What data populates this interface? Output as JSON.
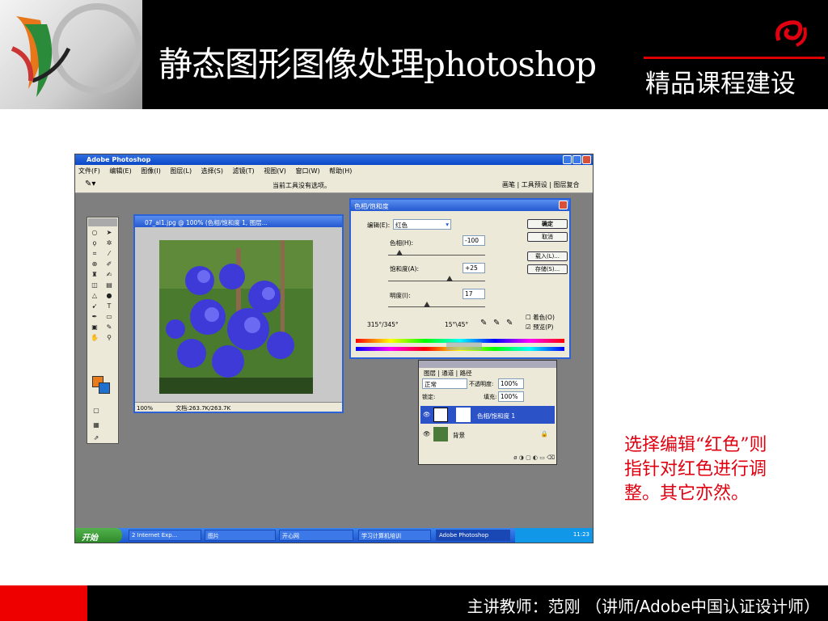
{
  "header": {
    "title": "静态图形图像处理photoshop",
    "subtitle": "精品课程建设"
  },
  "caption": "选择编辑“红色”则指针对红色进行调整。其它亦然。",
  "footer": {
    "teacher": "主讲教师：范刚 （讲师/Adobe中国认证设计师）"
  },
  "screenshot": {
    "app_title": "Adobe Photoshop",
    "menu": [
      "文件(F)",
      "编辑(E)",
      "图像(I)",
      "图层(L)",
      "选择(S)",
      "滤镜(T)",
      "视图(V)",
      "窗口(W)",
      "帮助(H)"
    ],
    "options_hint": "当前工具没有选项。",
    "options_tabs": "画笔 | 工具预设 | 图层复合",
    "document": {
      "title": "07_al1.jpg @ 100% (色相/饱和度 1, 图层...",
      "zoom": "100%",
      "doc_size": "文档:263.7K/263.7K"
    },
    "hue_dialog": {
      "title": "色相/饱和度",
      "edit_label": "编辑(E):",
      "edit_value": "红色",
      "hue_label": "色相(H):",
      "hue_value": "-100",
      "saturation_label": "饱和度(A):",
      "saturation_value": "+25",
      "lightness_label": "明度(I):",
      "lightness_value": "17",
      "range_left": "315°/345°",
      "range_right": "15°\\45°",
      "ok": "确定",
      "cancel": "取消",
      "load": "载入(L)...",
      "save": "存储(S)...",
      "colorize": "着色(O)",
      "preview": "预览(P)"
    },
    "layers_panel": {
      "tabs": "图层 | 通道 | 路径",
      "blend_mode": "正常",
      "opacity_label": "不透明度:",
      "opacity": "100%",
      "lock_label": "锁定:",
      "fill_label": "填充:",
      "fill": "100%",
      "layer1": "色相/饱和度 1",
      "layer2": "背景"
    },
    "taskbar": {
      "start": "开始",
      "tasks": [
        "2 Internet Exp...",
        "图片",
        "开心网",
        "学习计算机培训",
        "Adobe Photoshop"
      ],
      "clock": "11:23"
    }
  },
  "colors": {
    "accent_red": "#e00010",
    "xp_blue": "#2559d0"
  }
}
